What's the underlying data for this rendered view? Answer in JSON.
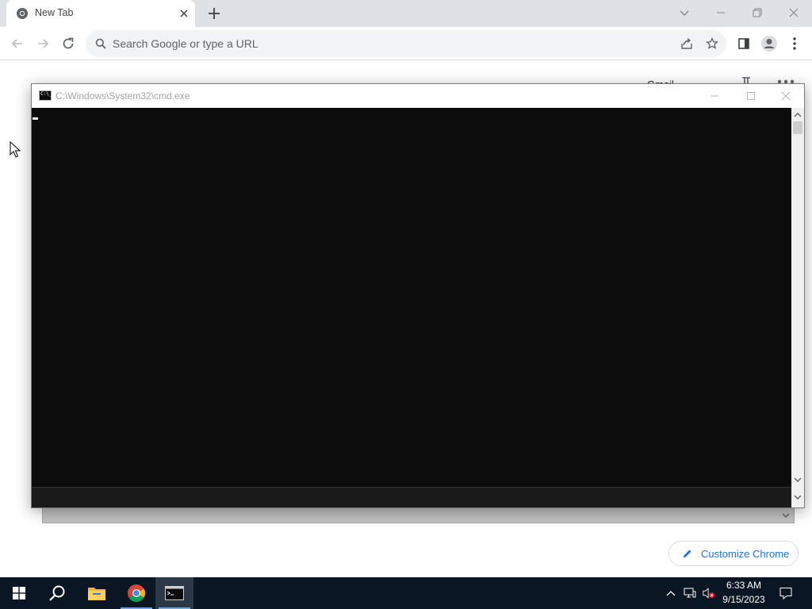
{
  "browser": {
    "tab": {
      "title": "New Tab"
    },
    "omnibox": {
      "placeholder": "Search Google or type a URL"
    },
    "toolbar_icons": [
      "back-arrow-icon",
      "forward-arrow-icon",
      "reload-icon",
      "share-icon",
      "star-icon",
      "side-panel-icon",
      "profile-icon",
      "kebab-menu-icon"
    ],
    "window_controls": [
      "tab-search-chevron-icon",
      "minimize-icon",
      "restore-icon",
      "close-icon"
    ]
  },
  "ntp": {
    "partial_label": "Gmail",
    "customize_label": "Customize Chrome"
  },
  "cmd": {
    "title": "C:\\Windows\\System32\\cmd.exe",
    "icon_text": "C:\\_"
  },
  "taskbar": {
    "items": [
      "start-icon",
      "search-icon",
      "file-explorer-icon",
      "chrome-icon",
      "cmd-icon"
    ],
    "active_item": "cmd-icon",
    "tray_icons": [
      "show-hidden-chevron-icon",
      "network-icon",
      "volume-muted-icon",
      "notification-icon"
    ],
    "time": "6:33 AM",
    "date": "9/15/2023"
  },
  "colors": {
    "tabstrip_bg": "#dee1e6",
    "cmd_bg": "#0c0c0c",
    "taskbar_bg": "#0b1624",
    "accent_blue": "#1a73e8"
  }
}
